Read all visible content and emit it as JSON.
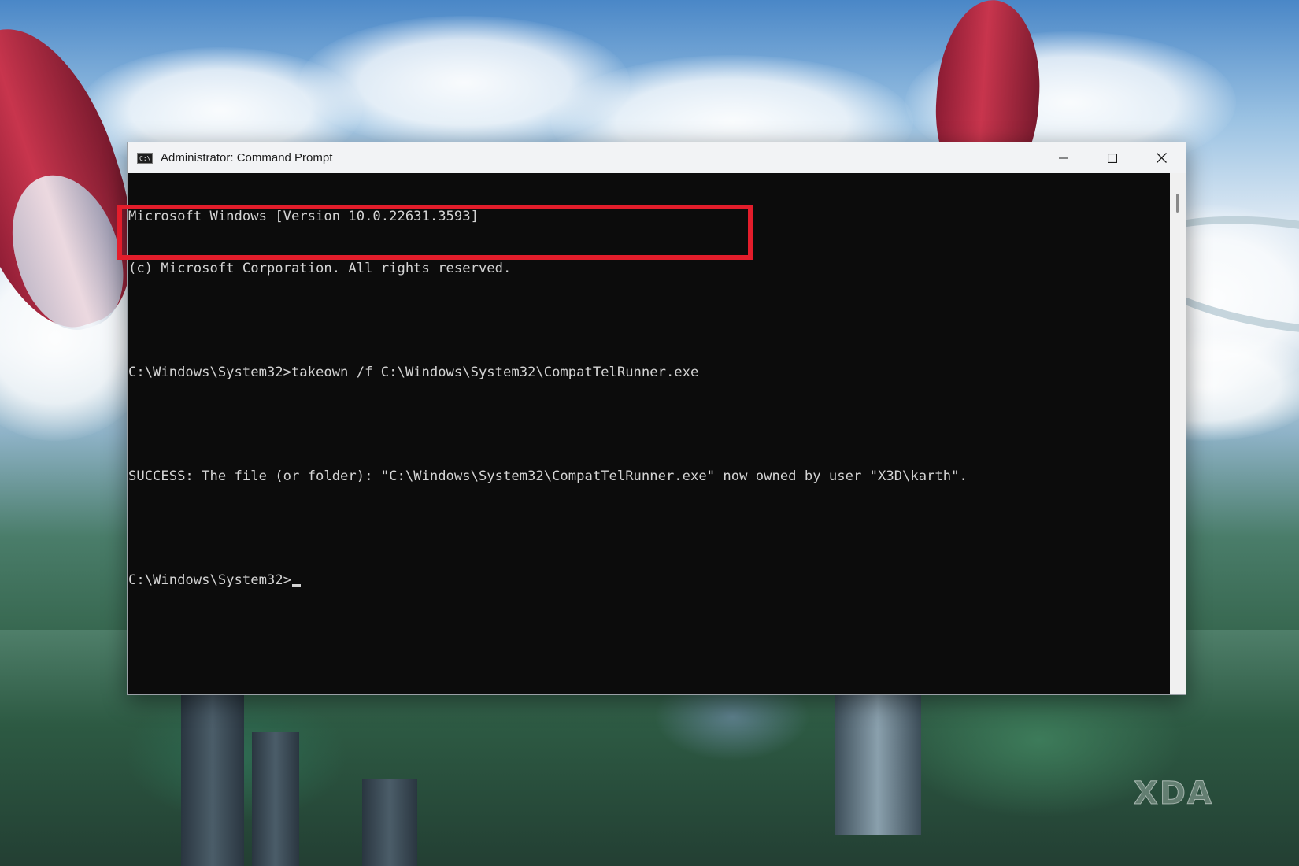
{
  "window": {
    "title": "Administrator: Command Prompt",
    "app_icon": "C:\\",
    "controls": {
      "minimize": "minimize-icon",
      "maximize": "maximize-icon",
      "close": "close-icon"
    }
  },
  "console": {
    "lines": [
      "Microsoft Windows [Version 10.0.22631.3593]",
      "(c) Microsoft Corporation. All rights reserved.",
      "",
      "C:\\Windows\\System32>takeown /f C:\\Windows\\System32\\CompatTelRunner.exe",
      "",
      "SUCCESS: The file (or folder): \"C:\\Windows\\System32\\CompatTelRunner.exe\" now owned by user \"X3D\\karth\".",
      ""
    ],
    "prompt": "C:\\Windows\\System32>"
  },
  "annotation": {
    "highlight_color": "#e31d2b"
  },
  "watermark": "XDA"
}
